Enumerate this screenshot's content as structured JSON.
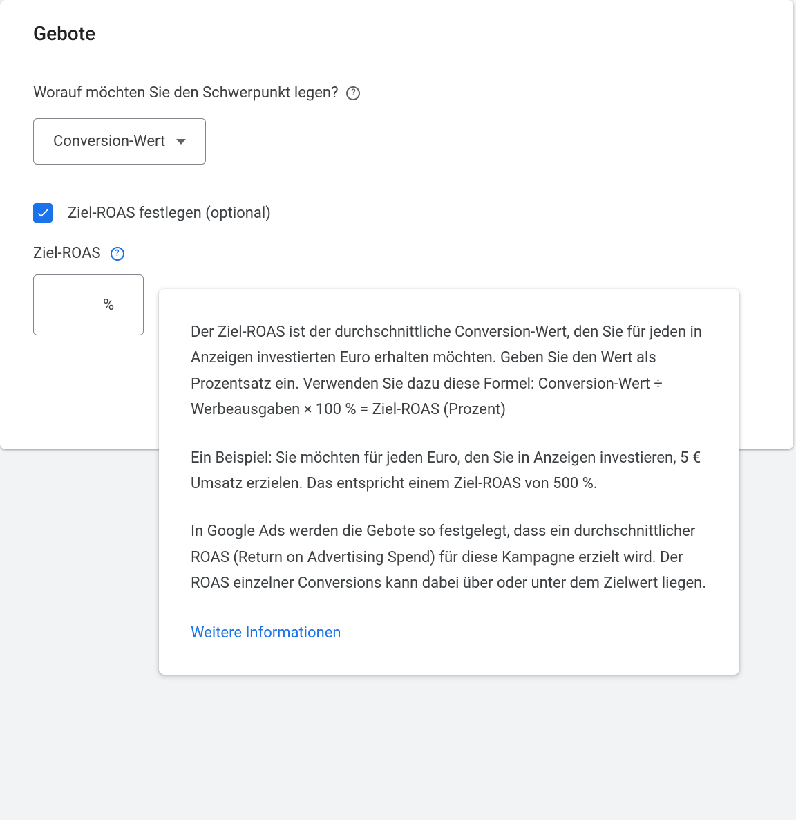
{
  "card": {
    "title": "Gebote"
  },
  "focus": {
    "question": "Worauf möchten Sie den Schwerpunkt legen?",
    "selected": "Conversion-Wert"
  },
  "targetRoas": {
    "checkbox_label": "Ziel-ROAS festlegen (optional)",
    "checked": true,
    "field_label": "Ziel-ROAS",
    "value": "",
    "suffix": "%"
  },
  "tooltip": {
    "para1": "Der Ziel-ROAS ist der durchschnittliche Conversion-Wert, den Sie für jeden in Anzeigen investierten Euro erhalten möchten. Geben Sie den Wert als Prozentsatz ein. Verwenden Sie dazu diese Formel: Conversion-Wert ÷ Werbeausgaben × 100 % = Ziel-ROAS (Prozent)",
    "para2": "Ein Beispiel: Sie möchten für jeden Euro, den Sie in Anzeigen investieren, 5 € Umsatz erzielen. Das entspricht einem Ziel-ROAS von 500 %.",
    "para3": "In Google Ads werden die Gebote so festgelegt, dass ein durchschnittlicher ROAS (Return on Advertising Spend) für diese Kampagne erzielt wird. Der ROAS einzelner Conversions kann dabei über oder unter dem Zielwert liegen.",
    "link": "Weitere Informationen"
  }
}
